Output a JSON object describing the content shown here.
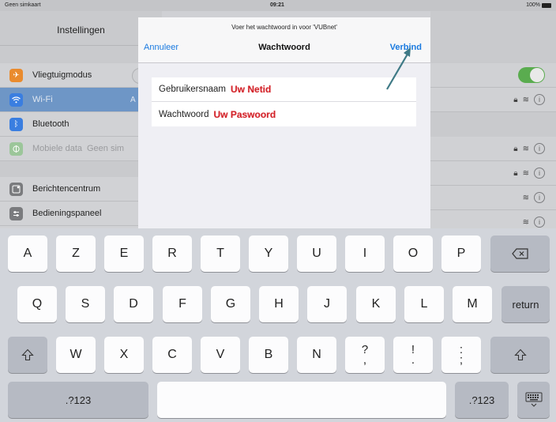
{
  "status_bar": {
    "carrier": "Geen simkaart",
    "time": "09:21",
    "battery": "100%"
  },
  "settings": {
    "title": "Instellingen",
    "items": [
      {
        "label": "Vliegtuigmodus",
        "icon": "airplane-icon",
        "color": "#e98b2e"
      },
      {
        "label": "Wi-Fi",
        "suffix": "A",
        "icon": "wifi-icon",
        "color": "#3a7ee0"
      },
      {
        "label": "Bluetooth",
        "icon": "bluetooth-icon",
        "color": "#3a7ee0"
      },
      {
        "label": "Mobiele data",
        "suffix": "Geen sim",
        "icon": "cellular-icon",
        "color": "#5ab04c"
      },
      {
        "label": "Berichtencentrum",
        "icon": "notifications-icon",
        "color": "#7a7b7e"
      },
      {
        "label": "Bedieningspaneel",
        "icon": "control-center-icon",
        "color": "#7a7b7e"
      }
    ]
  },
  "dialog": {
    "prompt": "Voer het wachtwoord in voor 'VUBnet'",
    "cancel_label": "Annuleer",
    "title": "Wachtwoord",
    "connect_label": "Verbind",
    "fields": [
      {
        "label": "Gebruikersnaam",
        "value": "Uw Netid"
      },
      {
        "label": "Wachtwoord",
        "value": "Uw Paswoord"
      }
    ]
  },
  "keyboard": {
    "row1": [
      "A",
      "Z",
      "E",
      "R",
      "T",
      "Y",
      "U",
      "I",
      "O",
      "P"
    ],
    "row2": [
      "Q",
      "S",
      "D",
      "F",
      "G",
      "H",
      "J",
      "K",
      "L",
      "M"
    ],
    "row3": [
      "W",
      "X",
      "C",
      "V",
      "B",
      "N"
    ],
    "row3_punct": [
      [
        "?",
        ","
      ],
      [
        "!",
        "."
      ],
      [
        ":",
        ";"
      ]
    ],
    "return_label": "return",
    "numbers_label": ".?123",
    "shift_icon": "shift-icon",
    "delete_icon": "delete-icon",
    "dismiss_icon": "keyboard-dismiss-icon"
  },
  "colors": {
    "accent": "#1a7ae0",
    "annotation": "#d2232a",
    "toggle_on": "#5aac4f"
  }
}
